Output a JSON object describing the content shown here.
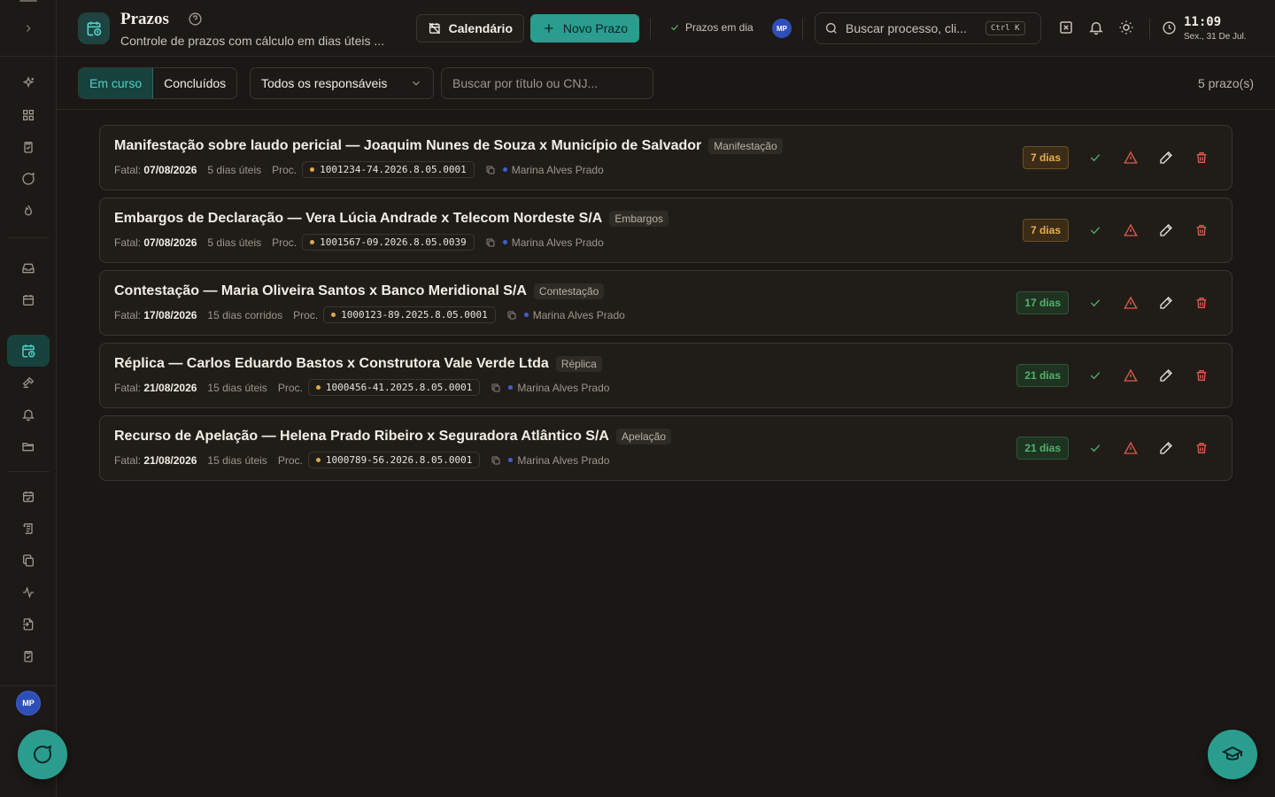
{
  "header": {
    "title": "Prazos",
    "subtitle": "Controle de prazos com cálculo em dias úteis ...",
    "calendar_label": "Calendário",
    "new_label": "Novo Prazo",
    "status_label": "Prazos em dia",
    "user_initials": "MP",
    "search_placeholder": "Buscar processo, cli...",
    "shortcut": "Ctrl K",
    "time": "11:09",
    "date": "Sex., 31 De Jul."
  },
  "filters": {
    "tabs": [
      {
        "label": "Em curso",
        "active": true
      },
      {
        "label": "Concluídos",
        "active": false
      }
    ],
    "responsible_select": "Todos os responsáveis",
    "search_placeholder": "Buscar por título ou CNJ...",
    "count": "5 prazo(s)"
  },
  "sidebar": {
    "user_initials": "MP"
  },
  "labels": {
    "fatal": "Fatal:",
    "proc": "Proc."
  },
  "deadlines": [
    {
      "title": "Manifestação sobre laudo pericial — Joaquim Nunes de Souza x Município de Salvador",
      "tag": "Manifestação",
      "fatal_date": "07/08/2026",
      "term": "5 dias úteis",
      "process": "1001234-74.2026.8.05.0001",
      "responsible": "Marina Alves Prado",
      "remaining": "7 dias",
      "urgency": "amber"
    },
    {
      "title": "Embargos de Declaração — Vera Lúcia Andrade x Telecom Nordeste S/A",
      "tag": "Embargos",
      "fatal_date": "07/08/2026",
      "term": "5 dias úteis",
      "process": "1001567-09.2026.8.05.0039",
      "responsible": "Marina Alves Prado",
      "remaining": "7 dias",
      "urgency": "amber"
    },
    {
      "title": "Contestação — Maria Oliveira Santos x Banco Meridional S/A",
      "tag": "Contestação",
      "fatal_date": "17/08/2026",
      "term": "15 dias corridos",
      "process": "1000123-89.2025.8.05.0001",
      "responsible": "Marina Alves Prado",
      "remaining": "17 dias",
      "urgency": "green"
    },
    {
      "title": "Réplica — Carlos Eduardo Bastos x Construtora Vale Verde Ltda",
      "tag": "Réplica",
      "fatal_date": "21/08/2026",
      "term": "15 dias úteis",
      "process": "1000456-41.2025.8.05.0001",
      "responsible": "Marina Alves Prado",
      "remaining": "21 dias",
      "urgency": "green"
    },
    {
      "title": "Recurso de Apelação — Helena Prado Ribeiro x Seguradora Atlântico S/A",
      "tag": "Apelação",
      "fatal_date": "21/08/2026",
      "term": "15 dias úteis",
      "process": "1000789-56.2026.8.05.0001",
      "responsible": "Marina Alves Prado",
      "remaining": "21 dias",
      "urgency": "green"
    }
  ],
  "colors": {
    "accent": "#2a9d8f",
    "accent_text": "#4fd1c5",
    "amber": "#e8b04d",
    "green": "#55b06a",
    "danger": "#e05a4a",
    "background": "#1a1714"
  }
}
